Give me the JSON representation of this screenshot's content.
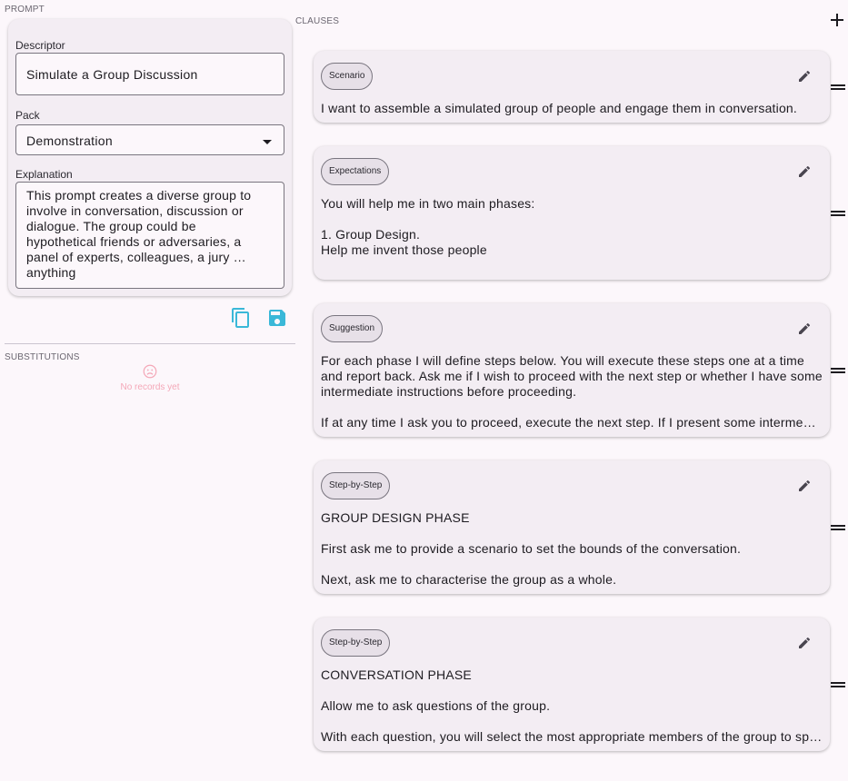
{
  "prompt": {
    "section_label": "PROMPT",
    "descriptor_label": "Descriptor",
    "descriptor_value": "Simulate a Group Discussion",
    "pack_label": "Pack",
    "pack_value": "Demonstration",
    "explanation_label": "Explanation",
    "explanation_value": "This prompt creates a diverse group to\ninvolve in conversation, discussion or\ndialogue. The group could be\nhypothetical friends or adversaries, a\npanel of experts, colleagues, a jury …\nanything",
    "actions": [
      "copy-icon",
      "save-icon"
    ],
    "accent_color": "#3ab8d8"
  },
  "substitutions": {
    "section_label": "SUBSTITUTIONS",
    "empty_icon": "sad-face-icon",
    "empty_text": "No records yet",
    "empty_color": "#f4a7b7"
  },
  "clauses": {
    "section_label": "CLAUSES",
    "add_icon": "plus-icon",
    "items": [
      {
        "tag": "Scenario",
        "lines": [
          "I want to assemble a simulated group of people and engage them in conversation."
        ]
      },
      {
        "tag": "Expectations",
        "lines": [
          "You will help me in two main phases:",
          "1. Group Design.",
          "Help me invent those people"
        ]
      },
      {
        "tag": "Suggestion",
        "lines": [
          "For each phase I will define steps below. You will execute these steps one at a time and report back. Ask me if I wish to proceed with the next step or whether I have some intermediate instructions before proceeding.",
          "If at any time I ask you to proceed, execute the next step. If I present some intermed…"
        ]
      },
      {
        "tag": "Step-by-Step",
        "lines": [
          "GROUP DESIGN PHASE",
          "First ask me to provide a scenario to set the bounds of the conversation.",
          "Next, ask me to characterise the group as a whole."
        ]
      },
      {
        "tag": "Step-by-Step",
        "lines": [
          "CONVERSATION PHASE",
          "Allow me to ask questions of the group.",
          "With each question, you will select the most appropriate members of the group to sp…"
        ]
      }
    ]
  }
}
